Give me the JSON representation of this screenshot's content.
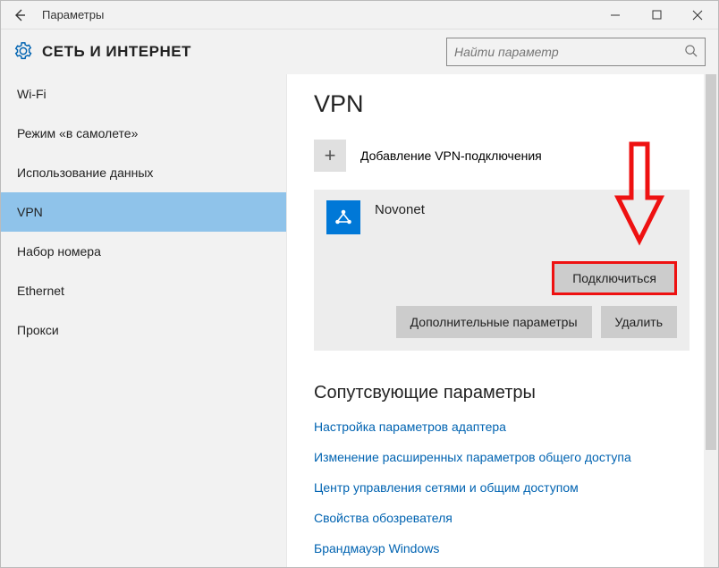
{
  "window": {
    "title": "Параметры"
  },
  "header": {
    "title": "СЕТЬ И ИНТЕРНЕТ",
    "search_placeholder": "Найти параметр"
  },
  "sidebar": {
    "items": [
      {
        "label": "Wi-Fi",
        "selected": false
      },
      {
        "label": "Режим «в самолете»",
        "selected": false
      },
      {
        "label": "Использование данных",
        "selected": false
      },
      {
        "label": "VPN",
        "selected": true
      },
      {
        "label": "Набор номера",
        "selected": false
      },
      {
        "label": "Ethernet",
        "selected": false
      },
      {
        "label": "Прокси",
        "selected": false
      }
    ]
  },
  "main": {
    "heading": "VPN",
    "add_label": "Добавление VPN-подключения",
    "connection": {
      "name": "Novonet",
      "connect_label": "Подключиться",
      "advanced_label": "Дополнительные параметры",
      "delete_label": "Удалить"
    },
    "related": {
      "heading": "Сопутсвующие параметры",
      "links": [
        "Настройка параметров адаптера",
        "Изменение расширенных параметров общего доступа",
        "Центр управления сетями и общим доступом",
        "Свойства обозревателя",
        "Брандмауэр Windows"
      ]
    }
  }
}
